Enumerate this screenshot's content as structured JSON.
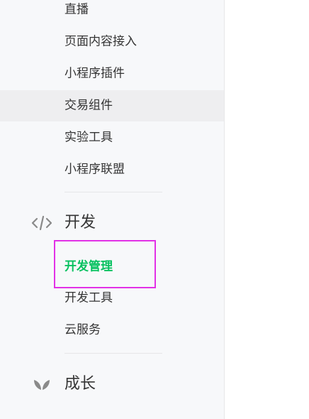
{
  "sidebar": {
    "top_items": [
      {
        "label": "直播"
      },
      {
        "label": "页面内容接入"
      },
      {
        "label": "小程序插件"
      },
      {
        "label": "交易组件"
      },
      {
        "label": "实验工具"
      },
      {
        "label": "小程序联盟"
      }
    ],
    "dev_group": {
      "title": "开发",
      "icon": "code-icon",
      "items": [
        {
          "label": "开发管理",
          "active": true
        },
        {
          "label": "开发工具"
        },
        {
          "label": "云服务"
        }
      ]
    },
    "growth_group": {
      "title": "成长",
      "icon": "sprout-icon"
    }
  },
  "colors": {
    "active": "#07c160",
    "text": "#353535",
    "sidebar_bg": "#f7f8fa",
    "hover_bg": "#eeeef0",
    "highlight": "#e231e6"
  }
}
